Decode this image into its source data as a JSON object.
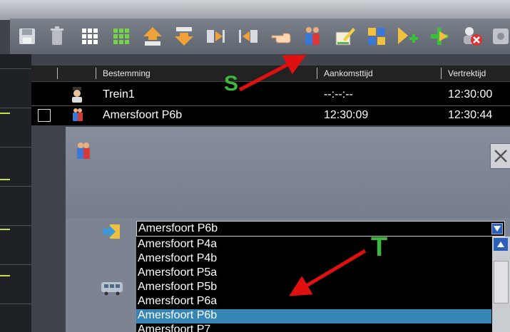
{
  "toolbar": {
    "buttons": [
      {
        "name": "save-icon",
        "color": "#c9ccd1"
      },
      {
        "name": "trash-icon",
        "color": "#c0c4ca"
      },
      {
        "name": "grid-white-icon",
        "color": "#ffffff"
      },
      {
        "name": "grid-green-icon",
        "color": "#76d44a"
      },
      {
        "name": "move-up-icon",
        "color": "#f0a23a"
      },
      {
        "name": "move-down-icon",
        "color": "#f0a23a"
      },
      {
        "name": "insert-right-icon",
        "color": "#d8dce0"
      },
      {
        "name": "insert-left-icon",
        "color": "#d8dce0"
      },
      {
        "name": "pointing-hand-icon",
        "color": "#ffd7b0"
      },
      {
        "name": "passengers-icon",
        "color": "#3a78d8"
      },
      {
        "name": "edit-schedule-icon",
        "color": "#f0d040"
      },
      {
        "name": "puzzle-icon",
        "color": "#f0c040"
      },
      {
        "name": "add-arrow-icon",
        "color": "#f0c040"
      },
      {
        "name": "add-plus-icon",
        "color": "#f0c040"
      },
      {
        "name": "delete-user-icon",
        "color": "#e03030"
      },
      {
        "name": "settings-icon",
        "color": "#c0c4ca"
      }
    ]
  },
  "timetable": {
    "headers": [
      "Bestemming",
      "Aankomsttijd",
      "Vertrektijd"
    ],
    "rows": [
      {
        "destination": "Trein1",
        "arrival": "--:--:--",
        "departure": "12:30:00",
        "icon": "conductor-icon"
      },
      {
        "destination": "Amersfoort P6b",
        "arrival": "12:30:09",
        "departure": "12:30:44",
        "icon": "passengers-icon"
      }
    ]
  },
  "dialog": {
    "selected_value": "Amersfoort P6b",
    "options": [
      "Amersfoort P4a",
      "Amersfoort P4b",
      "Amersfoort P5a",
      "Amersfoort P5b",
      "Amersfoort P6a",
      "Amersfoort P6b",
      "Amersfoort P7"
    ],
    "selected_index": 5
  },
  "annotations": {
    "label_s": "S",
    "label_t": "T",
    "arrow_color": "#e01010",
    "label_color": "#3cb93c"
  }
}
